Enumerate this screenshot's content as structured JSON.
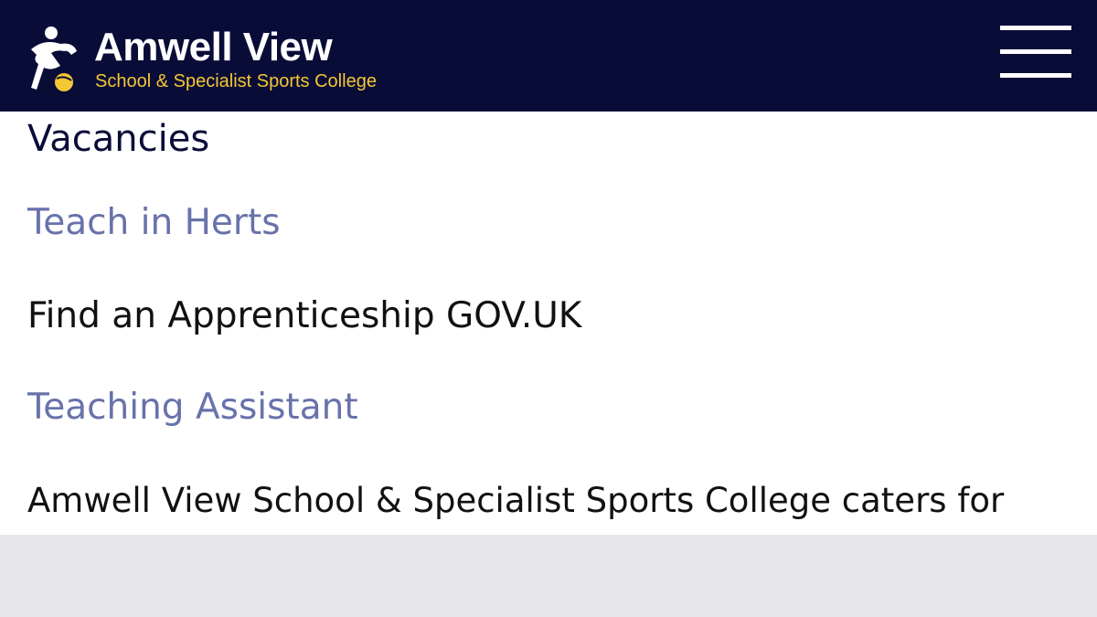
{
  "header": {
    "brand_name": "Amwell View",
    "tagline": "School & Specialist Sports College",
    "logo_icon": "running-figure-ball-icon",
    "menu_icon": "hamburger-menu-icon",
    "colors": {
      "background": "#0a0c38",
      "tagline": "#f4c734",
      "accent": "#f4c734"
    }
  },
  "main": {
    "title": "Vacancies",
    "items": [
      {
        "label": "Teach in Herts",
        "kind": "link"
      },
      {
        "label": "Find an Apprenticeship GOV.UK",
        "kind": "text"
      },
      {
        "label": "Teaching Assistant",
        "kind": "link"
      }
    ],
    "description": "Amwell View School & Specialist Sports College caters for",
    "colors": {
      "title": "#0a0c38",
      "link": "#6872ab",
      "text": "#111111"
    }
  }
}
